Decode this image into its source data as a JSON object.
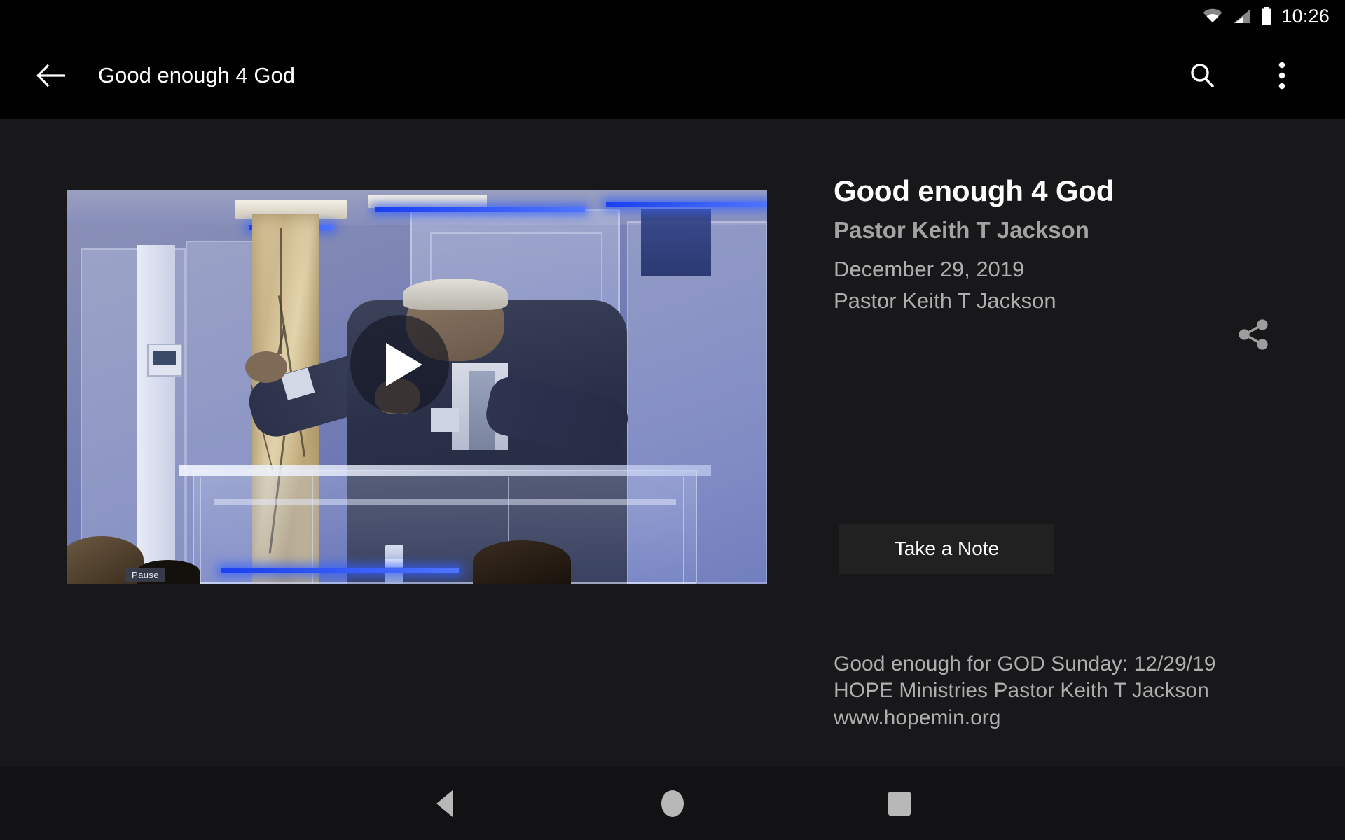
{
  "status_bar": {
    "time": "10:26",
    "icons": [
      "wifi-icon",
      "cellular-signal-icon",
      "battery-icon"
    ]
  },
  "app_bar": {
    "back_icon": "back-arrow-icon",
    "title": "Good enough 4 God",
    "search_icon": "search-icon",
    "overflow_icon": "overflow-menu-icon"
  },
  "video": {
    "pause_label": "Pause",
    "play_icon": "play-icon",
    "scene": "pastor in dark suit preaching at a clear acrylic podium in a blue-lit sanctuary"
  },
  "info": {
    "title": "Good enough 4 God",
    "speaker": "Pastor Keith T Jackson",
    "date": "December 29, 2019",
    "author": "Pastor Keith T Jackson",
    "share_icon": "share-icon",
    "take_note_label": "Take a Note",
    "description_lines": [
      "Good enough for GOD Sunday: 12/29/19",
      "HOPE Ministries Pastor Keith T Jackson",
      "www.hopemin.org"
    ]
  },
  "nav_bar": {
    "back_icon": "nav-back-icon",
    "home_icon": "nav-home-icon",
    "recents_icon": "nav-recents-icon"
  },
  "colors": {
    "app_bar_bg": "#000000",
    "page_bg": "#18181a",
    "button_bg": "#212121",
    "primary_text": "#fefefe",
    "secondary_text": "#aeaeae",
    "nav_bar_bg": "#121214",
    "nav_icon": "#b8b8b8"
  }
}
